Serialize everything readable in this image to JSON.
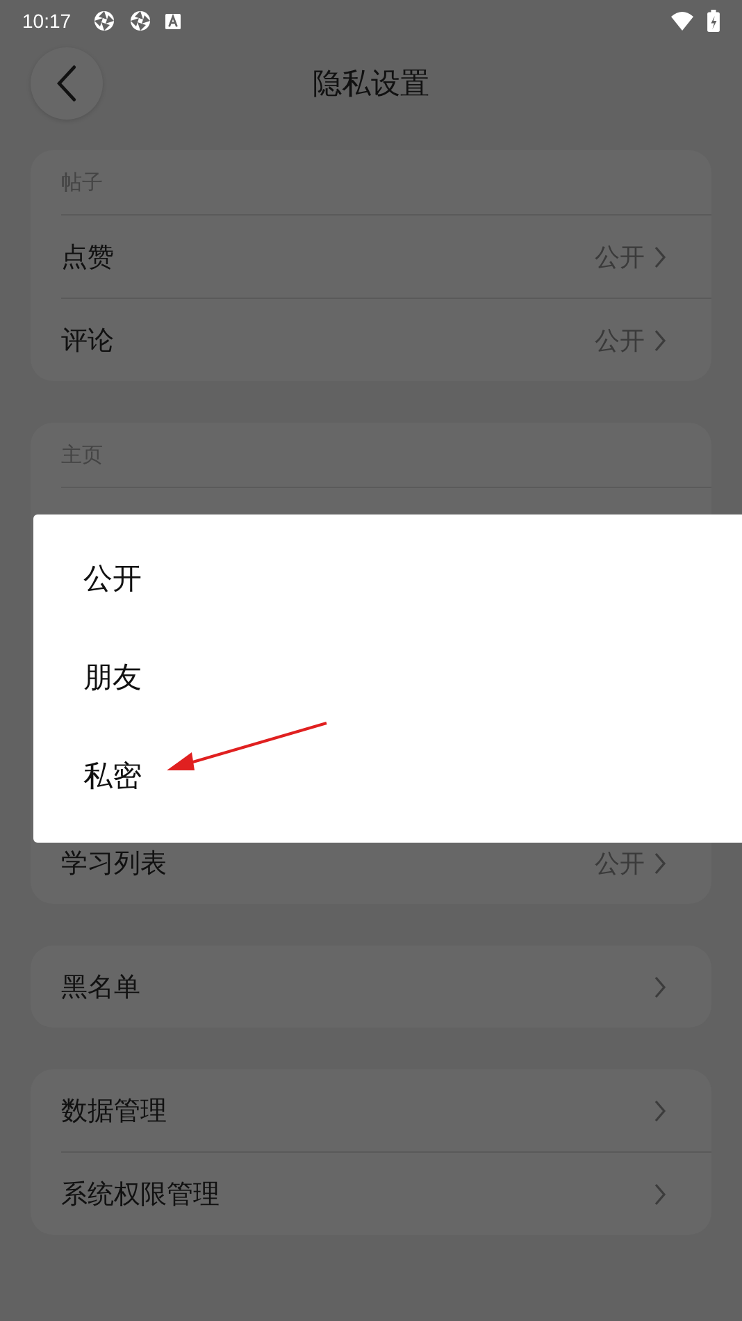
{
  "status_bar": {
    "time": "10:17"
  },
  "header": {
    "title": "隐私设置"
  },
  "sections": [
    {
      "title": "帖子",
      "rows": [
        {
          "label": "点赞",
          "value": "公开"
        },
        {
          "label": "评论",
          "value": "公开"
        }
      ]
    },
    {
      "title": "主页",
      "rows": [
        {
          "label": "学习列表",
          "value": "公开"
        }
      ]
    },
    {
      "rows": [
        {
          "label": "黑名单"
        }
      ]
    },
    {
      "rows": [
        {
          "label": "数据管理"
        },
        {
          "label": "系统权限管理"
        }
      ]
    }
  ],
  "menu": {
    "options": [
      "公开",
      "朋友",
      "私密"
    ]
  },
  "annotation": {
    "kind": "arrow"
  }
}
